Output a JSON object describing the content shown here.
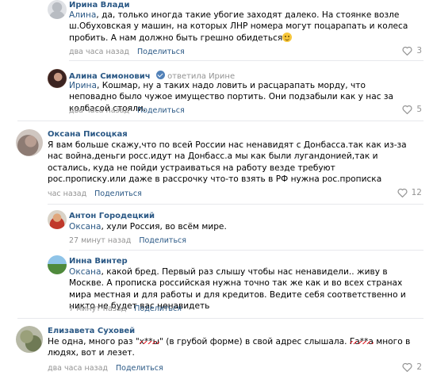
{
  "comments": [
    {
      "author": "Ирина Влади",
      "mention": "Алина",
      "text": ", да, только иногда такие убогие заходят далеко. На стоянке возле ш.Обуховская у машин, на которых ЛНР номера могут поцарапать и колеса пробить. А нам должно быть грешно обидеться",
      "time": "два часа назад",
      "share": "Поделиться",
      "likes": "3"
    },
    {
      "author": "Алина Симонович",
      "replied_label": "ответила Ирине",
      "mention": "Ирина",
      "text": ", Кошмар, ну а таких надо ловить и расцарапать морду, что неповадно было чужое имущество портить. Они подзабыли как у нас за колбасой стояли.",
      "time": "два часа назад",
      "share": "Поделиться",
      "likes": "5"
    },
    {
      "author": "Оксана Писоцкая",
      "text": "Я вам больше скажу,что по всей России нас ненавидят с Донбасса.так как из-за нас война,деньги росс.идут на Донбасс.а мы как были лугандонией,так и остались, куда не пойди устраиваться на работу везде требуют рос.прописку.или даже в рассрочку что-то взять в РФ нужна рос.прописка",
      "time": "час назад",
      "share": "Поделиться",
      "likes": "12"
    },
    {
      "author": "Антон Городецкий",
      "mention": "Оксана",
      "text": ", хули Россия, во всём мире.",
      "time": "27 минут назад",
      "share": "Поделиться"
    },
    {
      "author": "Инна Винтер",
      "mention": "Оксана",
      "text": ", какой бред. Первый раз слышу чтобы нас ненавидели.. живу в Москве. А прописка российская нужна точно так же как и во всех странах мира местная и для работы и для кредитов. Ведите себя соответственно и никто не будет вас ненавидеть",
      "time": "7 минут назад",
      "share": "Поделиться"
    },
    {
      "author": "Елизавета Суховей",
      "text_a": "Не одна, много раз \"",
      "censor_1": "х**ы",
      "text_b": "\" (в грубой форме) в свой адрес слышала. ",
      "censor_2": "Га**а",
      "text_c": " много в людях, вот и лезет.",
      "time": "два часа назад",
      "share": "Поделиться",
      "likes": "2"
    }
  ],
  "colors": {
    "link": "#2a5885",
    "muted": "#939393",
    "divider": "#e7e8ec",
    "censor": "#e0202a"
  }
}
